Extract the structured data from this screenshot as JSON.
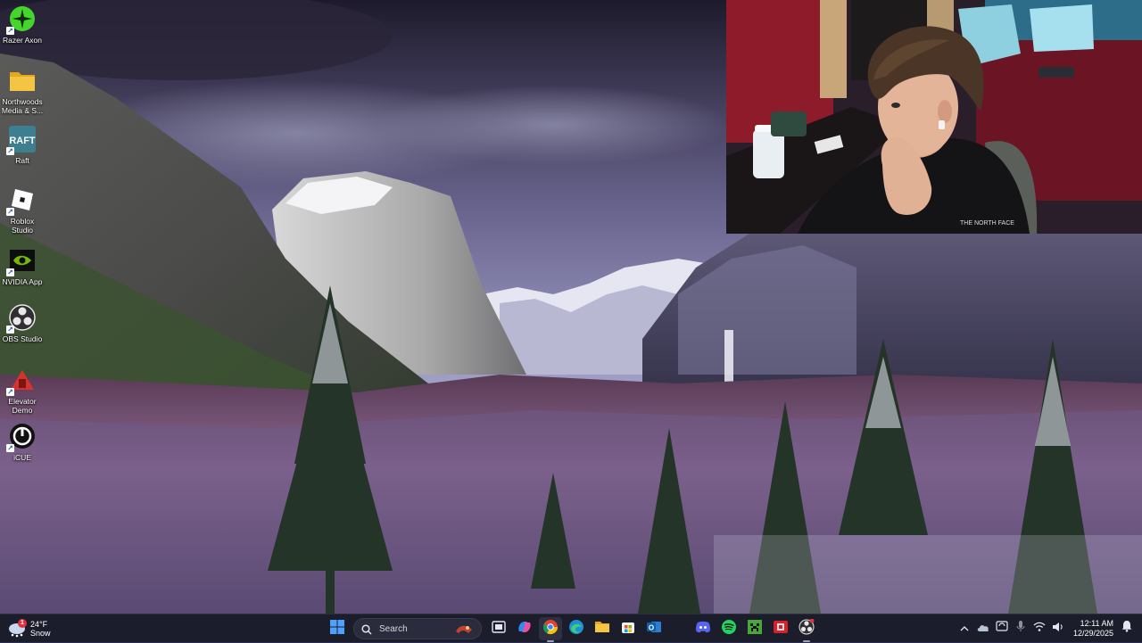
{
  "desktop": {
    "icons": [
      {
        "label": "Razer Axon",
        "icon": "razer-axon-icon",
        "color": "#44d62c"
      },
      {
        "label": "Northwoods Media & S...",
        "icon": "folder-icon",
        "color": "#f4c542"
      },
      {
        "label": "Raft",
        "icon": "raft-icon",
        "color": "#3d7f8f"
      },
      {
        "label": "Roblox Studio",
        "icon": "roblox-studio-icon",
        "color": "#ffffff"
      },
      {
        "label": "NVIDIA App",
        "icon": "nvidia-icon",
        "color": "#76b900"
      },
      {
        "label": "OBS Studio",
        "icon": "obs-studio-icon",
        "color": "#302e31"
      },
      {
        "label": "Elevator Demo",
        "icon": "elevator-demo-icon",
        "color": "#d8322c"
      },
      {
        "label": "iCUE",
        "icon": "icue-icon",
        "color": "#ffffff"
      }
    ]
  },
  "webcam": {
    "description_icon": "webcam-feed"
  },
  "taskbar": {
    "weather": {
      "temp": "24°F",
      "condition": "Snow",
      "badge": "1",
      "icon": "snow-weather-icon"
    },
    "search": {
      "placeholder": "Search"
    },
    "apps": [
      {
        "name": "start-button",
        "icon": "windows-icon"
      },
      {
        "name": "task-view-button",
        "icon": "task-view-icon"
      },
      {
        "name": "copilot-button",
        "icon": "copilot-icon"
      },
      {
        "name": "chrome-button",
        "icon": "chrome-icon"
      },
      {
        "name": "edge-button",
        "icon": "edge-icon"
      },
      {
        "name": "file-explorer-button",
        "icon": "folder-icon"
      },
      {
        "name": "store-button",
        "icon": "store-icon"
      },
      {
        "name": "outlook-button",
        "icon": "outlook-icon"
      },
      {
        "name": "discord-button",
        "icon": "discord-icon"
      },
      {
        "name": "spotify-button",
        "icon": "spotify-icon"
      },
      {
        "name": "minecraft-button",
        "icon": "minecraft-icon"
      },
      {
        "name": "red-app-button",
        "icon": "red-app-icon"
      },
      {
        "name": "obs-button",
        "icon": "obs-icon"
      }
    ],
    "clock": {
      "time": "12:11 AM",
      "date": "12/29/2025"
    }
  },
  "colors": {
    "taskbar_bg": "#1c1d2b",
    "accent": "#4ea1ff"
  }
}
